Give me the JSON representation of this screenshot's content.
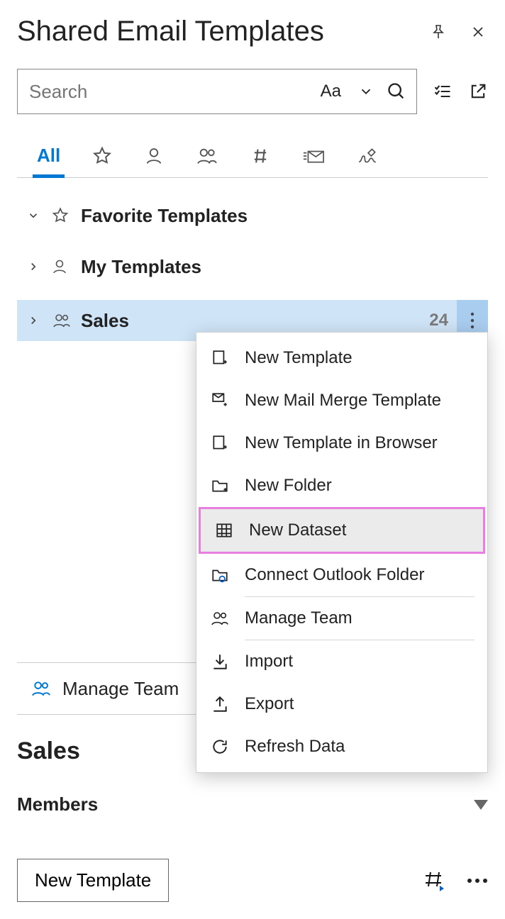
{
  "title": "Shared Email Templates",
  "search": {
    "placeholder": "Search",
    "case_label": "Aa"
  },
  "tabs": {
    "all": "All"
  },
  "tree": {
    "favorites": {
      "label": "Favorite Templates"
    },
    "my": {
      "label": "My Templates"
    },
    "sales": {
      "label": "Sales",
      "count": "24"
    }
  },
  "menu": {
    "new_template": "New Template",
    "new_mail_merge": "New Mail Merge Template",
    "new_in_browser": "New Template in Browser",
    "new_folder": "New Folder",
    "new_dataset": "New Dataset",
    "connect_outlook": "Connect Outlook Folder",
    "manage_team": "Manage Team",
    "import": "Import",
    "export": "Export",
    "refresh": "Refresh Data"
  },
  "manage_team_link": "Manage Team",
  "details": {
    "heading": "Sales",
    "members": "Members"
  },
  "bottom": {
    "new_template": "New Template"
  }
}
